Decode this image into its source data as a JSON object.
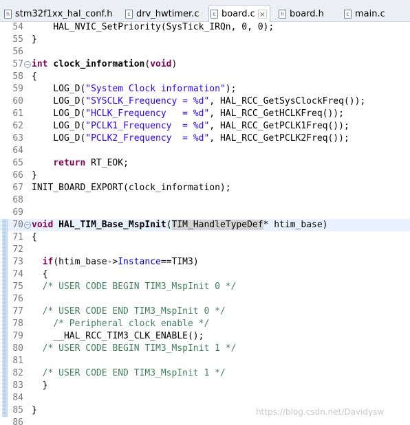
{
  "tabs": [
    {
      "label": "stm32f1xx_hal_conf.h",
      "icon": "h"
    },
    {
      "label": "drv_hwtimer.c",
      "icon": "c"
    },
    {
      "label": "board.c",
      "icon": "c",
      "active": true
    },
    {
      "label": "board.h",
      "icon": "h"
    },
    {
      "label": "main.c",
      "icon": "c"
    }
  ],
  "close_glyph": "✕",
  "lines": [
    {
      "n": "54",
      "tokens": [
        [
          "",
          "    "
        ],
        [
          "",
          "HAL_NVIC_SetPriority(SysTick_IRQn, 0, 0);"
        ]
      ]
    },
    {
      "n": "55",
      "tokens": [
        [
          "",
          "}"
        ]
      ]
    },
    {
      "n": "56",
      "tokens": []
    },
    {
      "n": "57",
      "fold": "−",
      "tokens": [
        [
          "kw",
          "int"
        ],
        [
          "",
          " "
        ],
        [
          "fn",
          "clock_information"
        ],
        [
          "",
          "("
        ],
        [
          "kw",
          "void"
        ],
        [
          "",
          ")"
        ]
      ]
    },
    {
      "n": "58",
      "tokens": [
        [
          "",
          "{"
        ]
      ]
    },
    {
      "n": "59",
      "tokens": [
        [
          "",
          "    LOG_D("
        ],
        [
          "str",
          "\"System Clock information\""
        ],
        [
          "",
          ");"
        ]
      ]
    },
    {
      "n": "60",
      "tokens": [
        [
          "",
          "    LOG_D("
        ],
        [
          "str",
          "\"SYSCLK_Frequency = %d\""
        ],
        [
          "",
          ", HAL_RCC_GetSysClockFreq());"
        ]
      ]
    },
    {
      "n": "61",
      "tokens": [
        [
          "",
          "    LOG_D("
        ],
        [
          "str",
          "\"HCLK_Frequency   = %d\""
        ],
        [
          "",
          ", HAL_RCC_GetHCLKFreq());"
        ]
      ]
    },
    {
      "n": "62",
      "tokens": [
        [
          "",
          "    LOG_D("
        ],
        [
          "str",
          "\"PCLK1_Frequency  = %d\""
        ],
        [
          "",
          ", HAL_RCC_GetPCLK1Freq());"
        ]
      ]
    },
    {
      "n": "63",
      "tokens": [
        [
          "",
          "    LOG_D("
        ],
        [
          "str",
          "\"PCLK2_Frequency  = %d\""
        ],
        [
          "",
          ", HAL_RCC_GetPCLK2Freq());"
        ]
      ]
    },
    {
      "n": "64",
      "tokens": []
    },
    {
      "n": "65",
      "tokens": [
        [
          "",
          "    "
        ],
        [
          "kw",
          "return"
        ],
        [
          "",
          " RT_EOK;"
        ]
      ]
    },
    {
      "n": "66",
      "tokens": [
        [
          "",
          "}"
        ]
      ]
    },
    {
      "n": "67",
      "tokens": [
        [
          "",
          "INIT_BOARD_EXPORT(clock_information);"
        ]
      ]
    },
    {
      "n": "68",
      "tokens": []
    },
    {
      "n": "69",
      "tokens": []
    },
    {
      "n": "70",
      "fold": "−",
      "marker": true,
      "current": true,
      "tokens": [
        [
          "kw",
          "void"
        ],
        [
          "",
          " "
        ],
        [
          "fn",
          "HAL_TIM_Base_MspInit"
        ],
        [
          "",
          "("
        ],
        [
          "hlref",
          "TIM_HandleTypeDef"
        ],
        [
          "",
          "* htim_base)"
        ]
      ]
    },
    {
      "n": "71",
      "marker": true,
      "tokens": [
        [
          "",
          "{"
        ]
      ]
    },
    {
      "n": "72",
      "marker": true,
      "tokens": []
    },
    {
      "n": "73",
      "marker": true,
      "tokens": [
        [
          "",
          "  "
        ],
        [
          "kw",
          "if"
        ],
        [
          "",
          "(htim_base->"
        ],
        [
          "fd",
          "Instance"
        ],
        [
          "",
          "==TIM3)"
        ]
      ]
    },
    {
      "n": "74",
      "marker": true,
      "tokens": [
        [
          "",
          "  {"
        ]
      ]
    },
    {
      "n": "75",
      "marker": true,
      "tokens": [
        [
          "",
          "  "
        ],
        [
          "cm",
          "/* USER CODE BEGIN TIM3_MspInit 0 */"
        ]
      ]
    },
    {
      "n": "76",
      "marker": true,
      "tokens": []
    },
    {
      "n": "77",
      "marker": true,
      "tokens": [
        [
          "",
          "  "
        ],
        [
          "cm",
          "/* USER CODE END TIM3_MspInit 0 */"
        ]
      ]
    },
    {
      "n": "78",
      "marker": true,
      "tokens": [
        [
          "",
          "    "
        ],
        [
          "cm",
          "/* Peripheral clock enable */"
        ]
      ]
    },
    {
      "n": "79",
      "marker": true,
      "tokens": [
        [
          "",
          "    __HAL_RCC_TIM3_CLK_ENABLE();"
        ]
      ]
    },
    {
      "n": "80",
      "marker": true,
      "tokens": [
        [
          "",
          "  "
        ],
        [
          "cm",
          "/* USER CODE BEGIN TIM3_MspInit 1 */"
        ]
      ]
    },
    {
      "n": "81",
      "marker": true,
      "tokens": []
    },
    {
      "n": "82",
      "marker": true,
      "tokens": [
        [
          "",
          "  "
        ],
        [
          "cm",
          "/* USER CODE END TIM3_MspInit 1 */"
        ]
      ]
    },
    {
      "n": "83",
      "marker": true,
      "tokens": [
        [
          "",
          "  }"
        ]
      ]
    },
    {
      "n": "84",
      "marker": true,
      "tokens": []
    },
    {
      "n": "85",
      "marker": true,
      "tokens": [
        [
          "",
          "}"
        ]
      ]
    },
    {
      "n": "86",
      "tokens": []
    }
  ],
  "watermark": "https://blog.csdn.net/Davidysw"
}
